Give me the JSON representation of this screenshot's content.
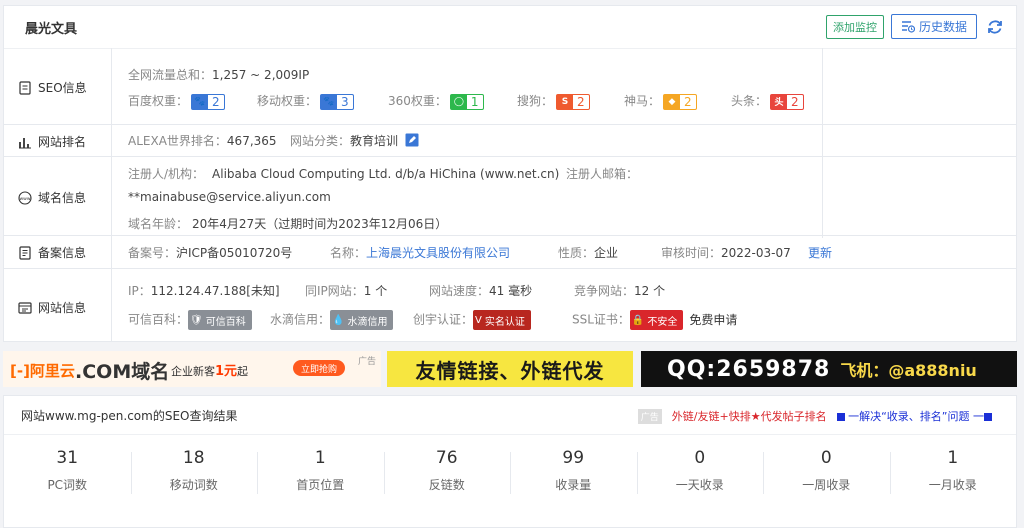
{
  "header": {
    "site_name": "晨光文具",
    "add_monitor": "添加监控",
    "history": "历史数据"
  },
  "seo": {
    "label": "SEO信息",
    "traffic_label": "全网流量总和：",
    "traffic_value": "1,257 ~ 2,009IP",
    "weights": [
      {
        "name": "百度权重：",
        "icon": "baidu-paw-icon",
        "value": "2",
        "color": "#3a77d6"
      },
      {
        "name": "移动权重：",
        "icon": "baidu-paw-icon",
        "value": "3",
        "color": "#3a77d6"
      },
      {
        "name": "360权重：",
        "icon": "360-icon",
        "value": "1",
        "color": "#2db84c"
      },
      {
        "name": "搜狗：",
        "icon": "sogou-icon",
        "value": "2",
        "color": "#ef5a2f"
      },
      {
        "name": "神马：",
        "icon": "shenma-icon",
        "value": "2",
        "color": "#f5a623"
      },
      {
        "name": "头条：",
        "icon": "toutiao-icon",
        "value": "2",
        "color": "#e8453c"
      }
    ]
  },
  "rank": {
    "label": "网站排名",
    "alexa_label": "ALEXA世界排名：",
    "alexa_value": "467,365",
    "category_label": "网站分类：",
    "category_value": "教育培训"
  },
  "domain": {
    "label": "域名信息",
    "registrant_label": "注册人/机构：",
    "registrant_value": "Alibaba Cloud Computing Ltd. d/b/a HiChina (www.net.cn)",
    "email_label": "注册人邮箱：",
    "email_value": "**mainabuse@service.aliyun.com",
    "age_label": "域名年龄：",
    "age_value": "20年4月27天（过期时间为2023年12月06日）"
  },
  "icp": {
    "label": "备案信息",
    "no_label": "备案号：",
    "no_value": "沪ICP备05010720号",
    "name_label": "名称：",
    "name_value": "上海晨光文具股份有限公司",
    "nature_label": "性质：",
    "nature_value": "企业",
    "date_label": "审核时间：",
    "date_value": "2022-03-07",
    "update": "更新"
  },
  "site": {
    "label": "网站信息",
    "ip_label": "IP：",
    "ip_value": "112.124.47.188[未知]",
    "same_ip_label": "同IP网站：",
    "same_ip_value": "1 个",
    "speed_label": "网站速度：",
    "speed_value": "41 毫秒",
    "competitor_label": "竞争网站：",
    "competitor_value": "12 个",
    "kexin_label": "可信百科：",
    "kexin_badge": "可信百科",
    "shuidi_label": "水滴信用：",
    "shuidi_badge": "水滴信用",
    "chuangyu_label": "创宇认证：",
    "chuangyu_badge": "实名认证",
    "ssl_label": "SSL证书：",
    "ssl_badge": "不安全",
    "ssl_apply": "免费申请"
  },
  "ads": {
    "aliyun_logo": "[-]阿里云",
    "aliyun_domain": ".COM域名",
    "aliyun_promo_prefix": "企业新客",
    "aliyun_promo_price": "1元",
    "aliyun_promo_suffix": "起",
    "aliyun_btn": "立即抢购",
    "ad_tag": "广告",
    "friend_link": "友情链接、外链代发",
    "qq": "QQ:2659878",
    "feiji": "飞机：@a888niu"
  },
  "results": {
    "title": "网站www.mg-pen.com的SEO查询结果",
    "ad_tag": "广告",
    "link1": "外链/友链+快排★代发帖子排名",
    "link2": "一解决“收录、排名”问题 一",
    "stats": [
      {
        "value": "31",
        "label": "PC词数"
      },
      {
        "value": "18",
        "label": "移动词数"
      },
      {
        "value": "1",
        "label": "首页位置"
      },
      {
        "value": "76",
        "label": "反链数"
      },
      {
        "value": "99",
        "label": "收录量"
      },
      {
        "value": "0",
        "label": "一天收录"
      },
      {
        "value": "0",
        "label": "一周收录"
      },
      {
        "value": "1",
        "label": "一月收录"
      }
    ]
  }
}
